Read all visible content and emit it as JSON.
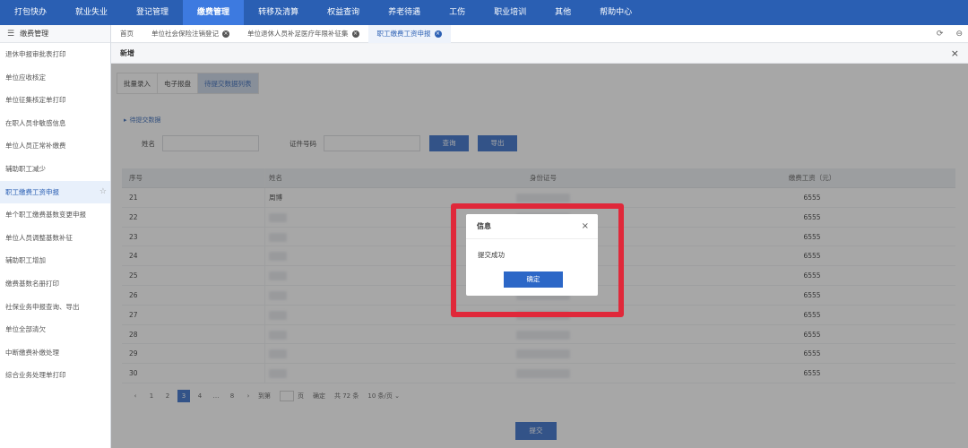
{
  "topnav": {
    "items": [
      "打包快办",
      "就业失业",
      "登记管理",
      "缴费管理",
      "转移及清算",
      "权益查询",
      "养老待遇",
      "工伤",
      "职业培训",
      "其他",
      "帮助中心"
    ],
    "active_index": 3
  },
  "sidebar": {
    "header": "缴费管理",
    "items": [
      "退休申报审批表打印",
      "单位应收核定",
      "单位征集核定单打印",
      "在职人员非敏感信息",
      "单位人员正常补缴费",
      "辅助职工减少",
      "职工缴费工资申报",
      "单个职工缴费基数变更申报",
      "单位人员调整基数补征",
      "辅助职工增加",
      "缴费基数名册打印",
      "社保业务申报查询、导出",
      "单位全部清欠",
      "中断缴费补缴处理",
      "综合业务处理单打印"
    ],
    "active_index": 6
  },
  "tabs": {
    "items": [
      "首页",
      "单位社会保险注销登记",
      "单位退休人员补足医疗年限补征集",
      "职工缴费工资申报"
    ],
    "active_index": 3
  },
  "panel": {
    "title": "新增"
  },
  "subtabs": {
    "items": [
      "批量录入",
      "电子报盘",
      "待提交数据列表"
    ],
    "active_index": 2
  },
  "section": {
    "title": "待提交数据"
  },
  "search": {
    "name_label": "姓名",
    "id_label": "证件号码",
    "query_button": "查询",
    "export_button": "导出"
  },
  "table": {
    "headers": [
      "序号",
      "姓名",
      "身份证号",
      "缴费工资（元）"
    ],
    "rows": [
      {
        "no": "21",
        "name": "周博",
        "wage": "6555"
      },
      {
        "no": "22",
        "name": "",
        "wage": "6555"
      },
      {
        "no": "23",
        "name": "",
        "wage": "6555"
      },
      {
        "no": "24",
        "name": "",
        "wage": "6555"
      },
      {
        "no": "25",
        "name": "",
        "wage": "6555"
      },
      {
        "no": "26",
        "name": "",
        "wage": "6555"
      },
      {
        "no": "27",
        "name": "",
        "wage": "6555"
      },
      {
        "no": "28",
        "name": "",
        "wage": "6555"
      },
      {
        "no": "29",
        "name": "",
        "wage": "6555"
      },
      {
        "no": "30",
        "name": "",
        "wage": "6555"
      }
    ]
  },
  "pager": {
    "prev": "‹",
    "pages": [
      "1",
      "2",
      "3",
      "4",
      "…",
      "8"
    ],
    "active_page": "3",
    "next": "›",
    "goto_label": "到第",
    "page_unit": "页",
    "confirm": "确定",
    "total": "共 72 条",
    "page_size": "10 条/页"
  },
  "submit_button": "提交",
  "dialog": {
    "title": "信息",
    "message": "提交成功",
    "ok_button": "确定"
  },
  "colors": {
    "nav_blue": "#2a5fb3",
    "button_blue": "#2c67c7",
    "highlight_red": "#e0283a"
  }
}
